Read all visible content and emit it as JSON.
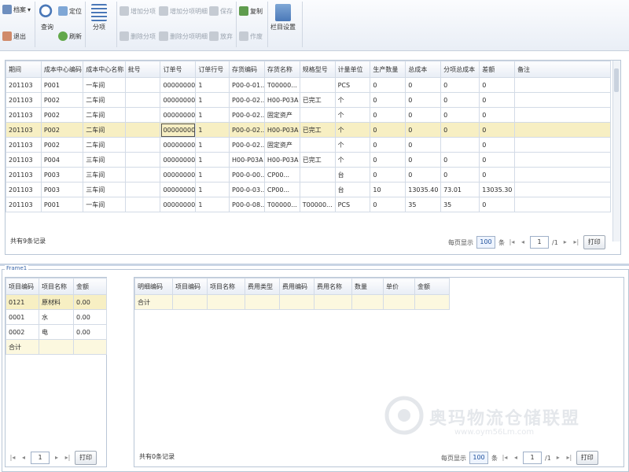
{
  "colors": {
    "accent": "#3a66a8",
    "selected_row": "#f7efc3",
    "header_bg": "#e8edf5"
  },
  "toolbar": {
    "file_menu": "档案",
    "exit": "退出",
    "query": "查询",
    "filter": "定位",
    "refresh": "刷新",
    "cost_center_alloc": "分项",
    "grp1_a": "增加分项",
    "grp1_b": "增加分项明细",
    "grp1_c": "保存",
    "grp1_d": "删除分项",
    "grp1_e": "删除分项明细",
    "grp1_f": "放弃",
    "copy": "复制",
    "void": "作废",
    "settings": "栏目设置"
  },
  "main": {
    "columns": [
      "期间",
      "成本中心编码",
      "成本中心名称",
      "批号",
      "订单号",
      "订单行号",
      "存货编码",
      "存货名称",
      "规格型号",
      "计量单位",
      "生产数量",
      "总成本",
      "分项总成本",
      "差额",
      "备注"
    ],
    "rows": [
      [
        "201103",
        "P001",
        "一车间",
        "",
        "0000000001",
        "1",
        "P00-0-01...",
        "T00000...",
        "",
        "PCS",
        "0",
        "0",
        "0",
        "0",
        ""
      ],
      [
        "201103",
        "P002",
        "二车间",
        "",
        "0000000002",
        "1",
        "P00-0-02...",
        "H00-P03A",
        "已完工",
        "个",
        "0",
        "0",
        "0",
        "0",
        ""
      ],
      [
        "201103",
        "P002",
        "二车间",
        "",
        "0000000003",
        "1",
        "P00-0-02...",
        "固定资产",
        "",
        "个",
        "0",
        "0",
        "0",
        "0",
        ""
      ],
      [
        "201103",
        "P002",
        "二车间",
        "",
        "0000000005",
        "1",
        "P00-0-02...",
        "H00-P03A",
        "已完工",
        "个",
        "0",
        "0",
        "0",
        "0",
        ""
      ],
      [
        "201103",
        "P002",
        "二车间",
        "",
        "0000000006",
        "1",
        "P00-0-02...",
        "固定资产",
        "",
        "个",
        "0",
        "0",
        "",
        "0",
        ""
      ],
      [
        "201103",
        "P004",
        "三车间",
        "",
        "0000000008",
        "1",
        "H00-P03A",
        "H00-P03A",
        "已完工",
        "个",
        "0",
        "0",
        "0",
        "0",
        ""
      ],
      [
        "201103",
        "P003",
        "三车间",
        "",
        "0000000009",
        "1",
        "P00-0-00...",
        "CP00...",
        "",
        "台",
        "0",
        "0",
        "0",
        "0",
        ""
      ],
      [
        "201103",
        "P003",
        "三车间",
        "",
        "0000000011",
        "1",
        "P00-0-03...",
        "CP00...",
        "",
        "台",
        "10",
        "13035.40",
        "73.01",
        "13035.30",
        ""
      ],
      [
        "201103",
        "P001",
        "一车间",
        "",
        "0000000014",
        "1",
        "P00-0-08...",
        "T00000...",
        "T00000...",
        "PCS",
        "0",
        "35",
        "35",
        "0",
        ""
      ]
    ],
    "selected_row_index": 3,
    "total_text": "共有9条记录",
    "page_size_label": "每页显示",
    "page_size": "100",
    "page_size_unit": "条",
    "page_current": "1",
    "page_total": "/1",
    "print_button": "打印"
  },
  "frame_label": "Frame1",
  "left_panel": {
    "columns": [
      "项目编码",
      "项目名称",
      "金额"
    ],
    "rows": [
      [
        "0121",
        "原材料",
        "0.00"
      ],
      [
        "0001",
        "水",
        "0.00"
      ],
      [
        "0002",
        "电",
        "0.00"
      ]
    ],
    "total_label": "合计",
    "page_current": "1",
    "print_button": "打印"
  },
  "right_panel": {
    "columns": [
      "明细编码",
      "项目编码",
      "项目名称",
      "费用类型",
      "费用编码",
      "费用名称",
      "数量",
      "单价",
      "金额"
    ],
    "total_label": "合计",
    "total_text": "共有0条记录",
    "page_size_label": "每页显示",
    "page_size": "100",
    "page_size_unit": "条",
    "page_current": "1",
    "page_total": "/1",
    "print_button": "打印"
  },
  "watermark": {
    "title": "奥玛物流仓储联盟",
    "url": "www.oym56Lm.com"
  }
}
